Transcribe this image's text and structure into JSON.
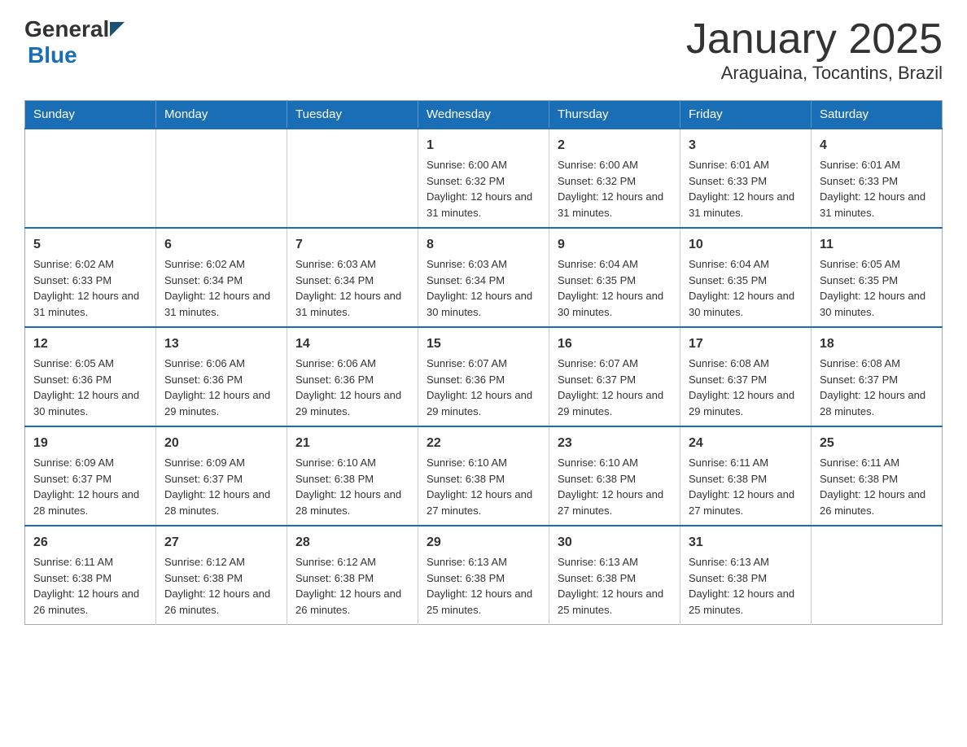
{
  "logo": {
    "text_general": "General",
    "text_blue": "Blue"
  },
  "title": {
    "month_year": "January 2025",
    "location": "Araguaina, Tocantins, Brazil"
  },
  "weekdays": [
    "Sunday",
    "Monday",
    "Tuesday",
    "Wednesday",
    "Thursday",
    "Friday",
    "Saturday"
  ],
  "weeks": [
    {
      "days": [
        {
          "num": "",
          "info": ""
        },
        {
          "num": "",
          "info": ""
        },
        {
          "num": "",
          "info": ""
        },
        {
          "num": "1",
          "info": "Sunrise: 6:00 AM\nSunset: 6:32 PM\nDaylight: 12 hours and 31 minutes."
        },
        {
          "num": "2",
          "info": "Sunrise: 6:00 AM\nSunset: 6:32 PM\nDaylight: 12 hours and 31 minutes."
        },
        {
          "num": "3",
          "info": "Sunrise: 6:01 AM\nSunset: 6:33 PM\nDaylight: 12 hours and 31 minutes."
        },
        {
          "num": "4",
          "info": "Sunrise: 6:01 AM\nSunset: 6:33 PM\nDaylight: 12 hours and 31 minutes."
        }
      ]
    },
    {
      "days": [
        {
          "num": "5",
          "info": "Sunrise: 6:02 AM\nSunset: 6:33 PM\nDaylight: 12 hours and 31 minutes."
        },
        {
          "num": "6",
          "info": "Sunrise: 6:02 AM\nSunset: 6:34 PM\nDaylight: 12 hours and 31 minutes."
        },
        {
          "num": "7",
          "info": "Sunrise: 6:03 AM\nSunset: 6:34 PM\nDaylight: 12 hours and 31 minutes."
        },
        {
          "num": "8",
          "info": "Sunrise: 6:03 AM\nSunset: 6:34 PM\nDaylight: 12 hours and 30 minutes."
        },
        {
          "num": "9",
          "info": "Sunrise: 6:04 AM\nSunset: 6:35 PM\nDaylight: 12 hours and 30 minutes."
        },
        {
          "num": "10",
          "info": "Sunrise: 6:04 AM\nSunset: 6:35 PM\nDaylight: 12 hours and 30 minutes."
        },
        {
          "num": "11",
          "info": "Sunrise: 6:05 AM\nSunset: 6:35 PM\nDaylight: 12 hours and 30 minutes."
        }
      ]
    },
    {
      "days": [
        {
          "num": "12",
          "info": "Sunrise: 6:05 AM\nSunset: 6:36 PM\nDaylight: 12 hours and 30 minutes."
        },
        {
          "num": "13",
          "info": "Sunrise: 6:06 AM\nSunset: 6:36 PM\nDaylight: 12 hours and 29 minutes."
        },
        {
          "num": "14",
          "info": "Sunrise: 6:06 AM\nSunset: 6:36 PM\nDaylight: 12 hours and 29 minutes."
        },
        {
          "num": "15",
          "info": "Sunrise: 6:07 AM\nSunset: 6:36 PM\nDaylight: 12 hours and 29 minutes."
        },
        {
          "num": "16",
          "info": "Sunrise: 6:07 AM\nSunset: 6:37 PM\nDaylight: 12 hours and 29 minutes."
        },
        {
          "num": "17",
          "info": "Sunrise: 6:08 AM\nSunset: 6:37 PM\nDaylight: 12 hours and 29 minutes."
        },
        {
          "num": "18",
          "info": "Sunrise: 6:08 AM\nSunset: 6:37 PM\nDaylight: 12 hours and 28 minutes."
        }
      ]
    },
    {
      "days": [
        {
          "num": "19",
          "info": "Sunrise: 6:09 AM\nSunset: 6:37 PM\nDaylight: 12 hours and 28 minutes."
        },
        {
          "num": "20",
          "info": "Sunrise: 6:09 AM\nSunset: 6:37 PM\nDaylight: 12 hours and 28 minutes."
        },
        {
          "num": "21",
          "info": "Sunrise: 6:10 AM\nSunset: 6:38 PM\nDaylight: 12 hours and 28 minutes."
        },
        {
          "num": "22",
          "info": "Sunrise: 6:10 AM\nSunset: 6:38 PM\nDaylight: 12 hours and 27 minutes."
        },
        {
          "num": "23",
          "info": "Sunrise: 6:10 AM\nSunset: 6:38 PM\nDaylight: 12 hours and 27 minutes."
        },
        {
          "num": "24",
          "info": "Sunrise: 6:11 AM\nSunset: 6:38 PM\nDaylight: 12 hours and 27 minutes."
        },
        {
          "num": "25",
          "info": "Sunrise: 6:11 AM\nSunset: 6:38 PM\nDaylight: 12 hours and 26 minutes."
        }
      ]
    },
    {
      "days": [
        {
          "num": "26",
          "info": "Sunrise: 6:11 AM\nSunset: 6:38 PM\nDaylight: 12 hours and 26 minutes."
        },
        {
          "num": "27",
          "info": "Sunrise: 6:12 AM\nSunset: 6:38 PM\nDaylight: 12 hours and 26 minutes."
        },
        {
          "num": "28",
          "info": "Sunrise: 6:12 AM\nSunset: 6:38 PM\nDaylight: 12 hours and 26 minutes."
        },
        {
          "num": "29",
          "info": "Sunrise: 6:13 AM\nSunset: 6:38 PM\nDaylight: 12 hours and 25 minutes."
        },
        {
          "num": "30",
          "info": "Sunrise: 6:13 AM\nSunset: 6:38 PM\nDaylight: 12 hours and 25 minutes."
        },
        {
          "num": "31",
          "info": "Sunrise: 6:13 AM\nSunset: 6:38 PM\nDaylight: 12 hours and 25 minutes."
        },
        {
          "num": "",
          "info": ""
        }
      ]
    }
  ]
}
